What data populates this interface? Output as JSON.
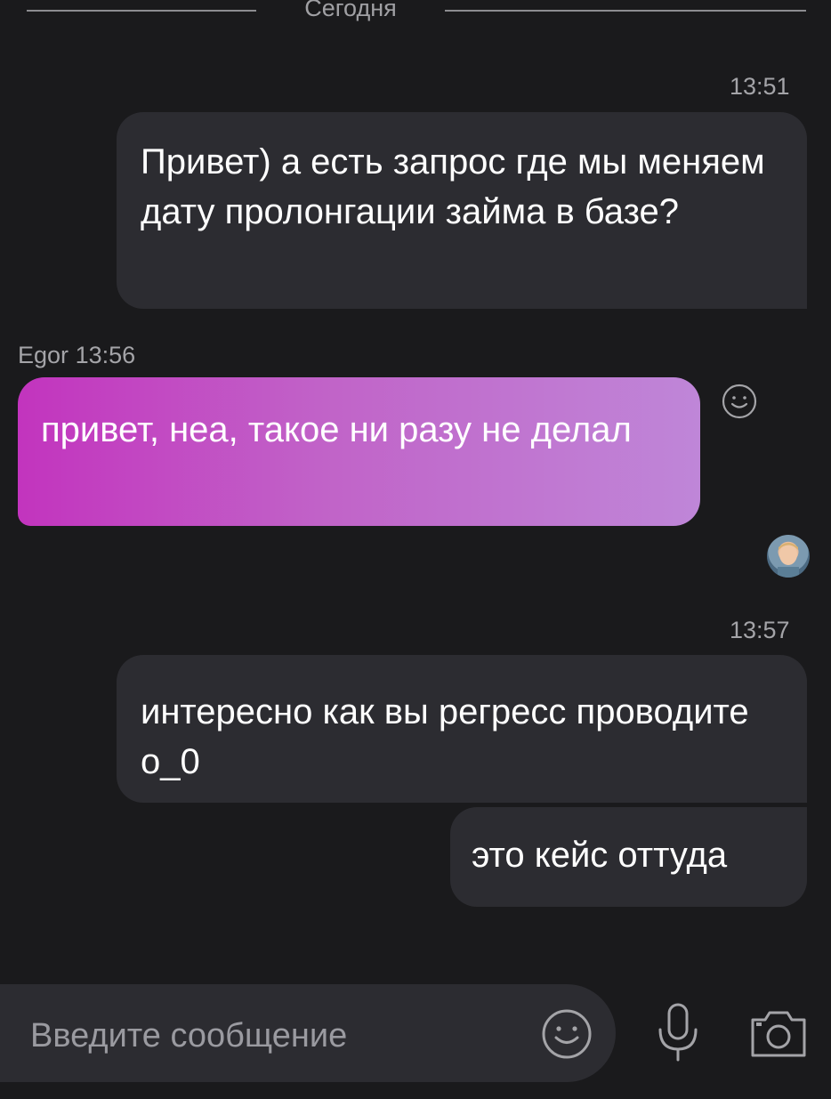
{
  "date_divider": {
    "label": "Сегодня"
  },
  "messages": [
    {
      "direction": "outgoing",
      "time": "13:51",
      "text": "Привет) а есть запрос где мы меняем дату пролонгации займа в базе?"
    },
    {
      "direction": "incoming",
      "sender": "Egor",
      "time": "13:56",
      "text": "привет, неа, такое ни разу не делал"
    },
    {
      "direction": "outgoing",
      "time": "13:57",
      "text": "интересно как вы регресс проводите о_0"
    },
    {
      "direction": "outgoing",
      "text": "это кейс оттуда"
    }
  ],
  "composer": {
    "placeholder": "Введите сообщение"
  },
  "icons": {
    "reaction": "smiley-outline-icon",
    "emoji": "emoji-icon",
    "microphone": "microphone-icon",
    "camera": "camera-icon"
  },
  "colors": {
    "background": "#1a1a1c",
    "outgoing_bubble": "#2c2c31",
    "incoming_bubble_gradient_start": "#c234be",
    "incoming_bubble_gradient_end": "#bf86d8"
  }
}
